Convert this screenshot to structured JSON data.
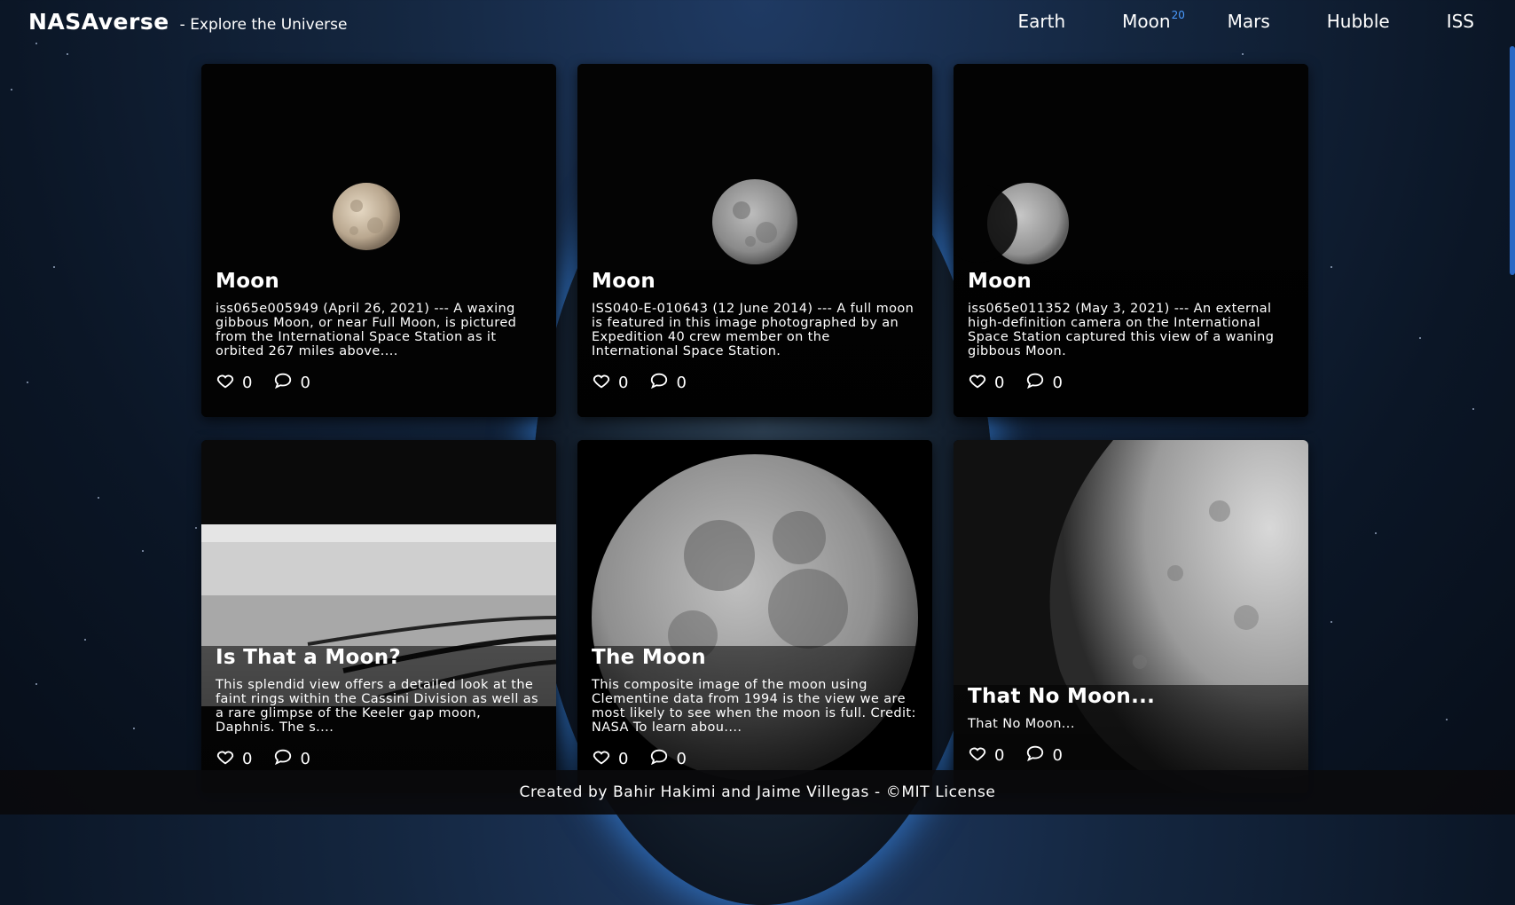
{
  "header": {
    "brand_title": "NASAverse",
    "brand_subtitle": "- Explore the Universe",
    "nav": [
      {
        "label": "Earth"
      },
      {
        "label": "Moon",
        "badge": "20"
      },
      {
        "label": "Mars"
      },
      {
        "label": "Hubble"
      },
      {
        "label": "ISS"
      }
    ]
  },
  "cards": [
    {
      "title": "Moon",
      "description": "iss065e005949 (April 26, 2021) --- A waxing gibbous Moon, or near Full Moon, is pictured from the International Space Station as it orbited 267 miles above....",
      "likes": "0",
      "comments": "0"
    },
    {
      "title": "Moon",
      "description": "ISS040-E-010643 (12 June 2014) --- A full moon is featured in this image photographed by an Expedition 40 crew member on the International Space Station.",
      "likes": "0",
      "comments": "0"
    },
    {
      "title": "Moon",
      "description": "iss065e011352 (May 3, 2021) --- An external high-definition camera on the International Space Station captured this view of a waning gibbous Moon.",
      "likes": "0",
      "comments": "0"
    },
    {
      "title": "Is That a Moon?",
      "description": "This splendid view offers a detailed look at the faint rings within the Cassini Division as well as a rare glimpse of the Keeler gap moon, Daphnis. The s....",
      "likes": "0",
      "comments": "0"
    },
    {
      "title": "The Moon",
      "description": "This composite image of the moon using Clementine data from 1994 is the view we are most likely to see when the moon is full. Credit: NASA To learn abou....",
      "likes": "0",
      "comments": "0"
    },
    {
      "title": "That No Moon...",
      "description": "That No Moon...",
      "likes": "0",
      "comments": "0"
    }
  ],
  "footer": {
    "text": "Created by Bahir Hakimi and Jaime Villegas - ©MIT License"
  },
  "colors": {
    "accent": "#4a9bff",
    "scrollbar": "#2b69c5"
  }
}
